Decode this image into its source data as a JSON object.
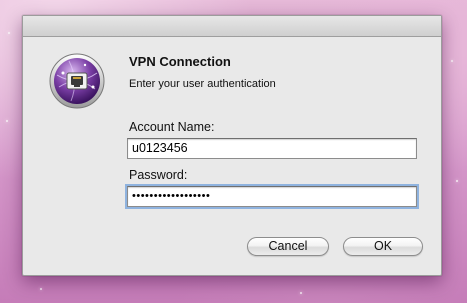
{
  "dialog": {
    "title": "VPN Connection",
    "message": "Enter your user authentication",
    "icon": "vpn-network-icon"
  },
  "form": {
    "account_label": "Account Name:",
    "account_value": "u0123456",
    "password_label": "Password:",
    "password_value": "••••••••••••••••••"
  },
  "buttons": {
    "cancel_label": "Cancel",
    "ok_label": "OK"
  },
  "colors": {
    "desktop": "#d79bcc",
    "dialog_bg": "#e9e9e9",
    "icon_accent": "#7b3fa6",
    "focus_ring": "#8fb3df"
  }
}
